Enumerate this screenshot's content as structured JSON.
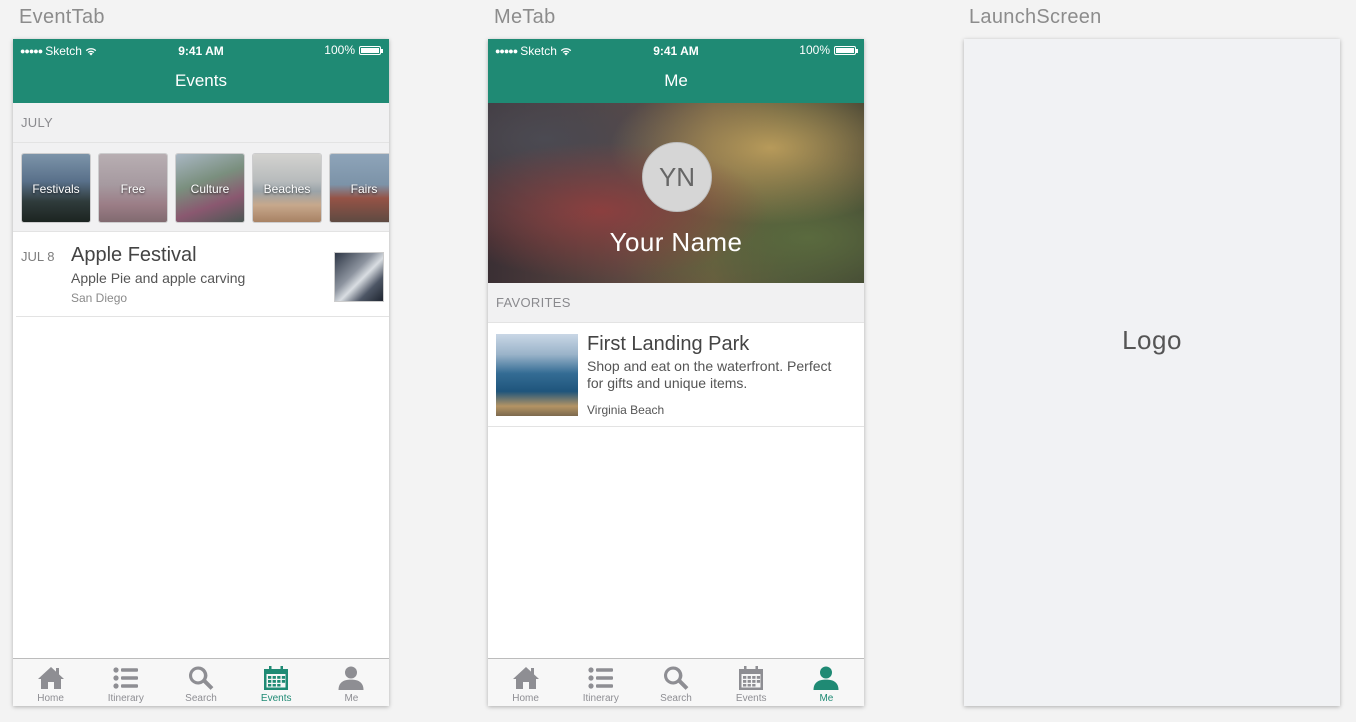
{
  "artboards": {
    "event_tab": "EventTab",
    "me_tab": "MeTab",
    "launch_screen": "LaunchScreen"
  },
  "status_bar": {
    "carrier": "Sketch",
    "time": "9:41 AM",
    "battery": "100%"
  },
  "event_tab": {
    "title": "Events",
    "section": "JULY",
    "categories": [
      "Festivals",
      "Free",
      "Culture",
      "Beaches",
      "Fairs"
    ],
    "event": {
      "date": "JUL 8",
      "title": "Apple Festival",
      "description": "Apple Pie and apple carving",
      "location": "San Diego"
    },
    "active_tab": "Events"
  },
  "me_tab": {
    "title": "Me",
    "initials": "YN",
    "name": "Your Name",
    "section": "FAVORITES",
    "favorite": {
      "title": "First Landing Park",
      "description": "Shop and eat on the waterfront. Perfect for gifts and unique items.",
      "location": "Virginia Beach"
    },
    "active_tab": "Me"
  },
  "tabs": [
    "Home",
    "Itinerary",
    "Search",
    "Events",
    "Me"
  ],
  "launch": {
    "logo": "Logo"
  },
  "colors": {
    "primary": "#1f8a74",
    "tab_inactive": "#8e8e93",
    "section_bg": "#f1f1f2"
  },
  "icons": [
    "home-icon",
    "list-icon",
    "search-icon",
    "calendar-icon",
    "person-icon",
    "wifi-icon",
    "battery-icon"
  ]
}
